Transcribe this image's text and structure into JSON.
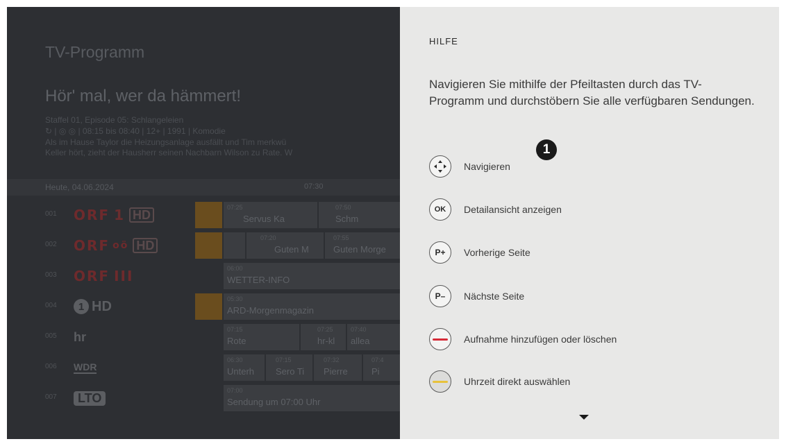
{
  "epg": {
    "title": "TV-Programm",
    "show": {
      "title": "Hör' mal, wer da hämmert!",
      "episode": "Staffel 01, Episode 05: Schlangeleien",
      "meta": "08:15 bis 08:40  |  12+  |  1991  |  Komodie",
      "desc_1": "Als im Hause Taylor die Heizungsanlage ausfällt und Tim merkwü",
      "desc_2": "Keller hört, zieht der Hausherr seinen Nachbarn Wilson zu Rate. W"
    },
    "date": "Heute, 04.06.2024",
    "time": "07:30",
    "channels": [
      {
        "num": "001",
        "programs": [
          {
            "time": "07:25",
            "name": "Servus Ka"
          },
          {
            "time": "07:50",
            "name": "Schm"
          }
        ]
      },
      {
        "num": "002",
        "programs": [
          {
            "time": "07:20",
            "name": "Guten M"
          },
          {
            "time": "07:55",
            "name": "Guten Morge"
          }
        ]
      },
      {
        "num": "003",
        "programs": [
          {
            "time": "06:00",
            "name": "WETTER-INFO"
          }
        ]
      },
      {
        "num": "004",
        "programs": [
          {
            "time": "05:30",
            "name": "ARD-Morgenmagazin"
          }
        ]
      },
      {
        "num": "005",
        "programs": [
          {
            "time": "07:15",
            "name": "Rote"
          },
          {
            "time": "07:25",
            "name": "hr-kl"
          },
          {
            "time": "07:40",
            "name": "allea"
          }
        ]
      },
      {
        "num": "006",
        "programs": [
          {
            "time": "06:30",
            "name": "Unterh"
          },
          {
            "time": "07:15",
            "name": "Sero Ti"
          },
          {
            "time": "07:32",
            "name": "Pierre"
          },
          {
            "time": "07:4",
            "name": "Pi"
          }
        ]
      },
      {
        "num": "007",
        "programs": [
          {
            "time": "07:00",
            "name": "Sendung um 07:00 Uhr"
          }
        ]
      }
    ],
    "logos": {
      "orf1": "ORF",
      "orf1_num": "1",
      "orf2": "ORF",
      "orf2_sub": "oö",
      "orf3": "ORF",
      "orf3_num": "III",
      "hd": "HD",
      "ard_num": "1",
      "hr": "hr",
      "wdr": "WDR",
      "lto": "LTO"
    }
  },
  "help": {
    "header": "HILFE",
    "intro": "Navigieren Sie mithilfe der Pfeiltasten durch das TV-Programm und durchstöbern Sie alle verfügbaren Sendungen.",
    "step_badge": "1",
    "items": [
      {
        "icon": "dpad-icon",
        "key": "",
        "label": "Navigieren"
      },
      {
        "icon": "ok-key-icon",
        "key": "OK",
        "label": "Detailansicht anzeigen"
      },
      {
        "icon": "p-plus-key-icon",
        "key": "P+",
        "label": "Vorherige Seite"
      },
      {
        "icon": "p-minus-key-icon",
        "key": "P–",
        "label": "Nächste Seite"
      },
      {
        "icon": "red-key-icon",
        "key": "",
        "label": "Aufnahme hinzufügen oder löschen",
        "color": "#d62b38"
      },
      {
        "icon": "yellow-key-icon",
        "key": "",
        "label": "Uhrzeit direkt auswählen",
        "color": "#e8c23a"
      }
    ]
  },
  "colors": {
    "panel_bg": "#e8e8e7",
    "epg_bg": "#2d2f33",
    "badge": "#1a1a1a",
    "orange_block": "#6a4d1e"
  }
}
